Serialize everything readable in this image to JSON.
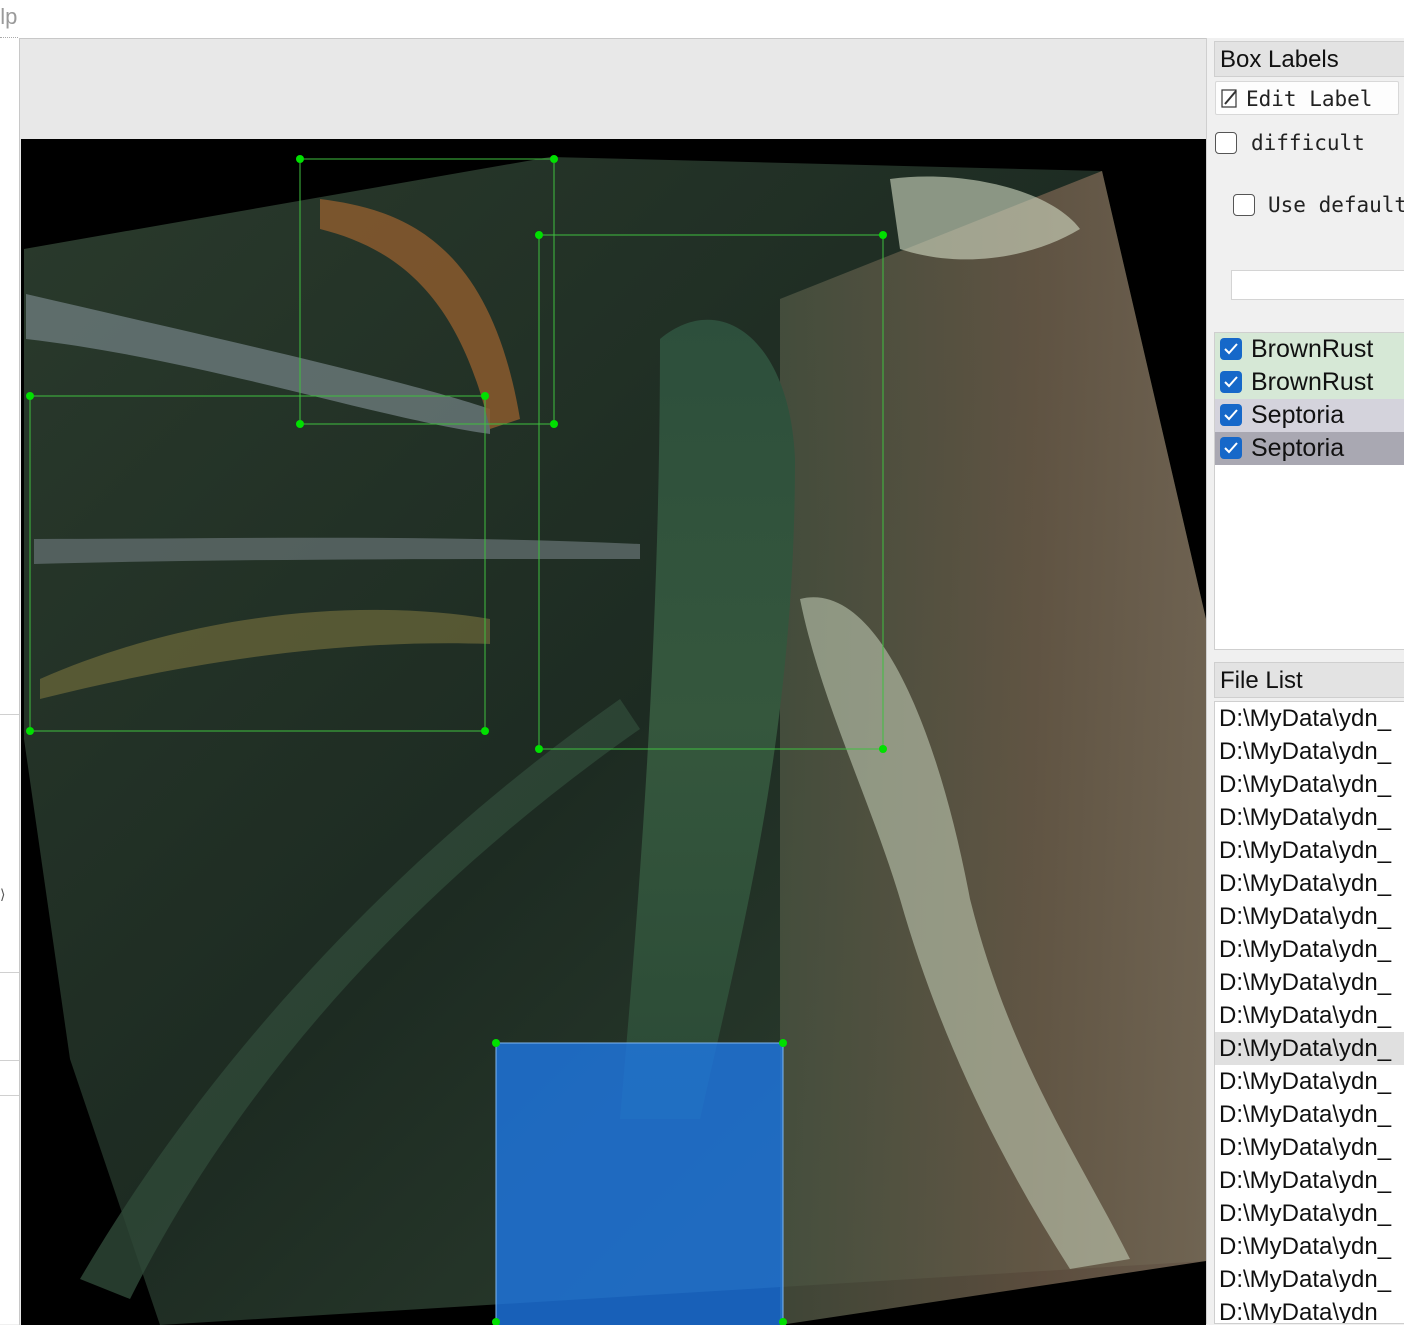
{
  "menubar": {
    "help_fragment": "elp"
  },
  "canvas": {
    "image_description_free": true,
    "boxes": [
      {
        "label": "BrownRust",
        "color": "#00ff00"
      },
      {
        "label": "BrownRust",
        "color": "#00ff00"
      },
      {
        "label": "Septoria",
        "color": "#00ff00"
      },
      {
        "label": "Septoria",
        "color": "#00ff00"
      },
      {
        "label": "selected",
        "fill": "#1e78e6"
      }
    ]
  },
  "dock": {
    "box_labels": {
      "title": "Box Labels",
      "edit_label": "Edit Label",
      "difficult_label": "difficult",
      "difficult_checked": false,
      "use_default_label": "Use default",
      "use_default_checked": false,
      "default_value": "",
      "items": [
        {
          "label": "BrownRust",
          "checked": true,
          "bg": "#d6e8d6"
        },
        {
          "label": "BrownRust",
          "checked": true,
          "bg": "#d6e8d6"
        },
        {
          "label": "Septoria",
          "checked": true,
          "bg": "#d4d3dc"
        },
        {
          "label": "Septoria",
          "checked": true,
          "bg": "#a9a8b2"
        }
      ]
    },
    "file_list": {
      "title": "File List",
      "selected_index": 10,
      "items": [
        "D:\\MyData\\ydn_",
        "D:\\MyData\\ydn_",
        "D:\\MyData\\ydn_",
        "D:\\MyData\\ydn_",
        "D:\\MyData\\ydn_",
        "D:\\MyData\\ydn_",
        "D:\\MyData\\ydn_",
        "D:\\MyData\\ydn_",
        "D:\\MyData\\ydn_",
        "D:\\MyData\\ydn_",
        "D:\\MyData\\ydn_",
        "D:\\MyData\\ydn_",
        "D:\\MyData\\ydn_",
        "D:\\MyData\\ydn_",
        "D:\\MyData\\ydn_",
        "D:\\MyData\\ydn_",
        "D:\\MyData\\ydn_",
        "D:\\MyData\\ydn_",
        "D:\\MyData\\ydn_"
      ]
    }
  }
}
